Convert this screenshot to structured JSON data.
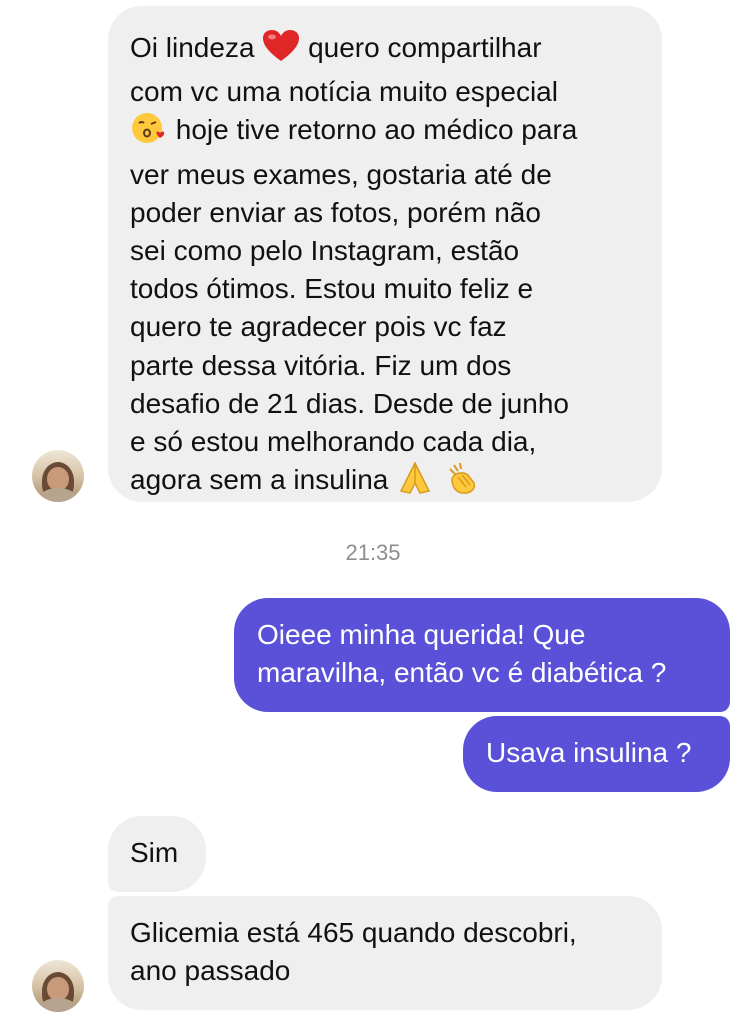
{
  "conversation": {
    "timestamp": "21:35",
    "incoming_first": {
      "lines": [
        "Oi lindeza",
        "quero compartilhar",
        "com vc uma notícia muito especial",
        "hoje tive retorno ao médico para",
        "ver meus exames, gostaria até de",
        "poder enviar as fotos, porém não",
        "sei como pelo Instagram, estão",
        "todos ótimos. Estou muito feliz e",
        "quero te agradecer pois vc faz",
        "parte dessa vitória. Fiz um dos",
        "desafio de 21 dias. Desde de junho",
        "e só estou melhorando cada dia,",
        "agora sem a insulina"
      ]
    },
    "outgoing_1": {
      "lines": [
        "Oieee minha querida! Que",
        "maravilha, então vc é diabética ?"
      ]
    },
    "outgoing_2": {
      "text": "Usava insulina ?"
    },
    "incoming_sim": {
      "text": "Sim"
    },
    "incoming_last": {
      "lines": [
        "Glicemia está 465 quando descobri,",
        "ano passado"
      ]
    }
  },
  "emoji": {
    "heart": "red-heart",
    "kiss": "face-blowing-kiss",
    "pray": "folded-hands",
    "clap": "clapping-hands"
  },
  "colors": {
    "incoming_bubble": "#efefef",
    "outgoing_bubble": "#5b51d8",
    "timestamp": "#8e8e8e"
  }
}
